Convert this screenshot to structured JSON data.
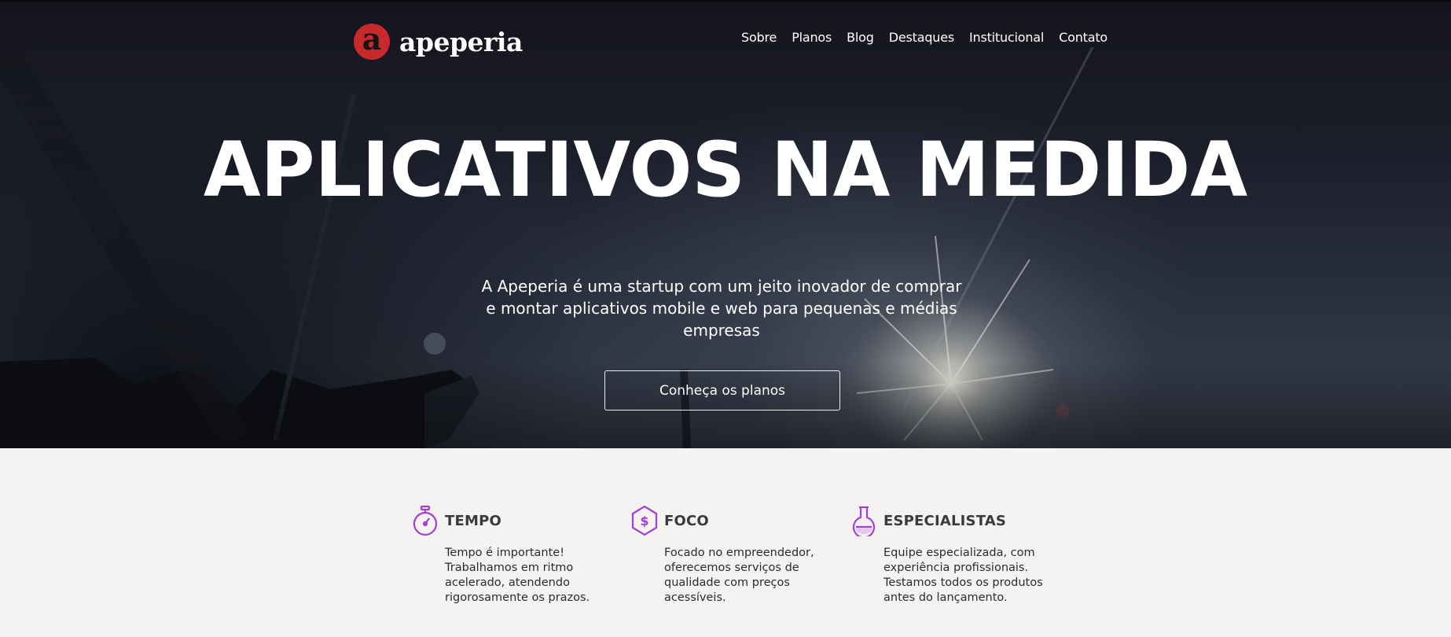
{
  "header": {
    "logo_letter": "a",
    "logo_text": "apeperia",
    "logo_color": "#c8292d",
    "nav": [
      {
        "label": "Sobre"
      },
      {
        "label": "Planos"
      },
      {
        "label": "Blog"
      },
      {
        "label": "Destaques"
      },
      {
        "label": "Institucional"
      },
      {
        "label": "Contato"
      }
    ]
  },
  "hero": {
    "title": "APLICATIVOS NA MEDIDA",
    "subtitle": "A Apeperia é uma startup com um jeito inovador de comprar e montar aplicativos mobile e web para pequenas e médias empresas",
    "cta_label": "Conheça os planos"
  },
  "features": {
    "accent_color": "#a43fd6",
    "items": [
      {
        "icon": "stopwatch-icon",
        "title": "TEMPO",
        "description": "Tempo é importante! Trabalhamos em ritmo acelerado, atendendo rigorosamente os prazos."
      },
      {
        "icon": "dollar-hexagon-icon",
        "title": "FOCO",
        "description": "Focado no empreendedor, oferecemos serviços de qualidade com preços acessíveis."
      },
      {
        "icon": "flask-icon",
        "title": "ESPECIALISTAS",
        "description": "Equipe especializada, com experiência profissionais. Testamos todos os produtos antes do lançamento."
      }
    ]
  }
}
